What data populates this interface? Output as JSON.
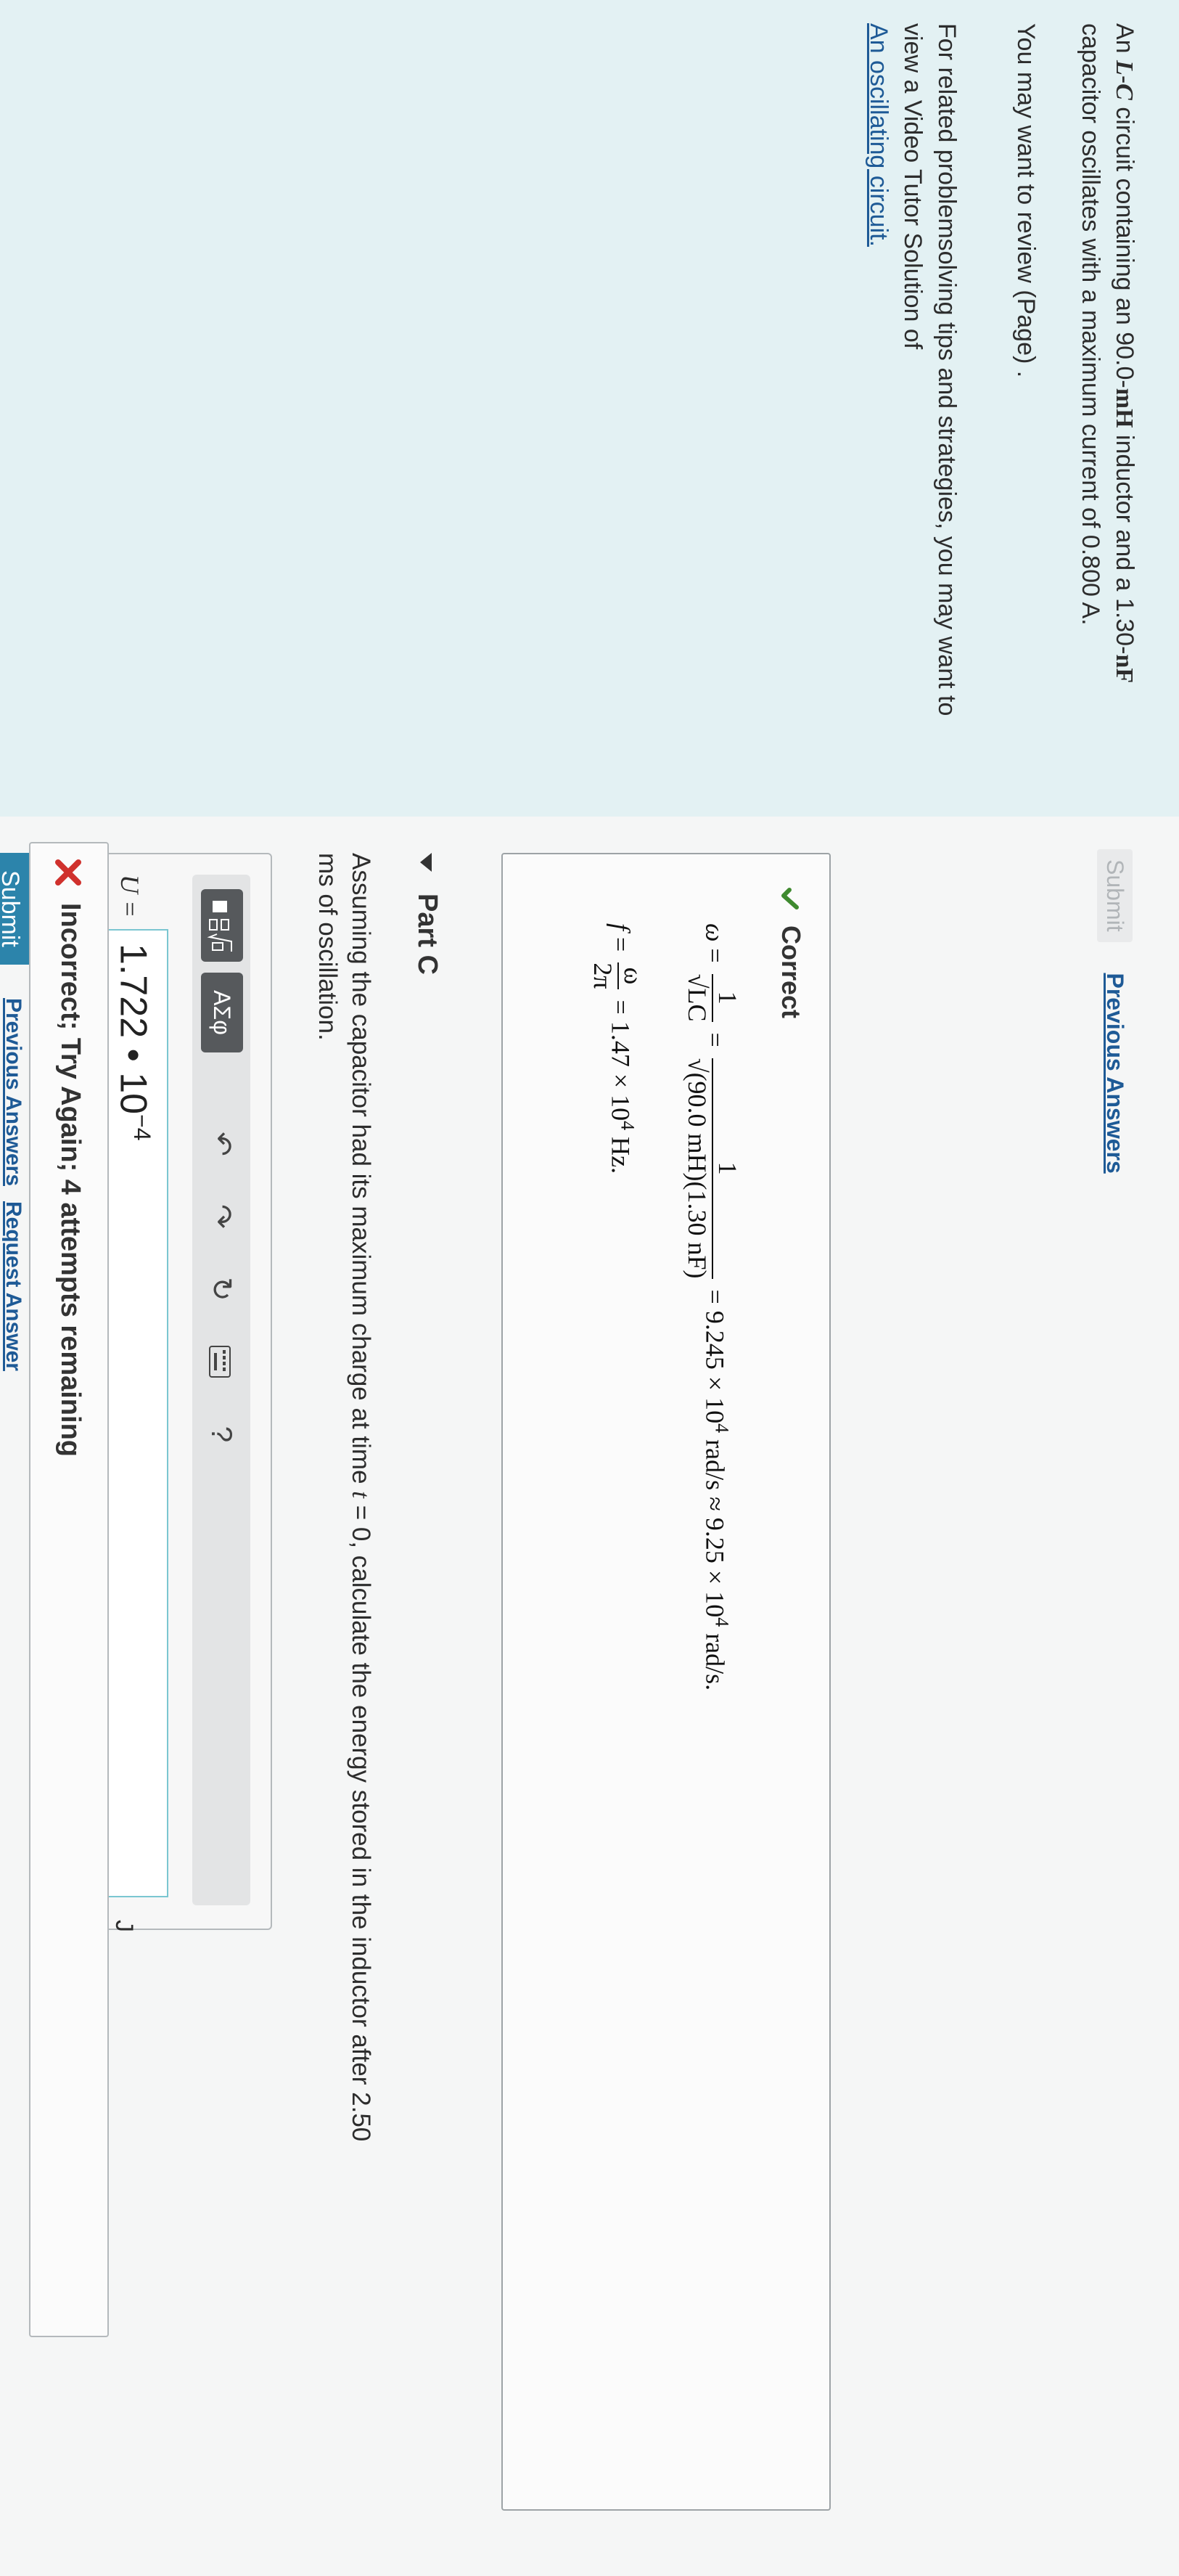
{
  "problem": {
    "p1_a": "An ",
    "p1_L": "L",
    "p1_dash": "-",
    "p1_C": "C",
    "p1_b": " circuit containing an 90.0-",
    "p1_mH": "mH",
    "p1_c": " inductor and a 1.30-",
    "p1_nF": "nF",
    "p1_d": " capacitor oscillates with a maximum current of 0.800 A.",
    "review": "You may want to review (Page) .",
    "tips": "For related problemsolving tips and strategies, you may want to view a Video Tutor Solution of",
    "tips_link": "An oscillating circuit."
  },
  "previous": {
    "submit_label": "Submit",
    "prev_answers_label": "Previous Answers"
  },
  "correct": {
    "title": "Correct",
    "omega": "ω",
    "eq": "=",
    "one": "1",
    "sqrtLC": "√LC",
    "sqrt_values": "√(90.0 mH)(1.30 nF)",
    "omega_result": "= 9.245 × 10",
    "exp4": "4",
    "omega_unit": " rad/s ≈ 9.25 × 10",
    "omega_unit2": " rad/s.",
    "f": "f",
    "omega_num": "ω",
    "two_pi": "2π",
    "f_result": "= 1.47 × 10",
    "f_unit": " Hz."
  },
  "part_c": {
    "title": "Part C",
    "question_a": "Assuming the capacitor had its maximum charge at time ",
    "t": "t",
    "question_b": " = 0, calculate the energy stored in the inductor after 2.50",
    "question_c": "ms of oscillation.",
    "toolbar_greek": "ΑΣφ",
    "u_label": "U =",
    "input_value": "1.722 • 10",
    "input_exp": "−4",
    "unit": "J",
    "submit_label": "Submit",
    "prev_answers_label": "Previous Answers",
    "request_label": "Request Answer",
    "feedback": "Incorrect; Try Again; 4 attempts remaining"
  },
  "colors": {
    "problem_bg": "#e3f1f3",
    "link": "#1e5a96",
    "submit_bg": "#2c84ab",
    "correct_check": "#3f8a2f",
    "incorrect_x": "#d0312d"
  }
}
